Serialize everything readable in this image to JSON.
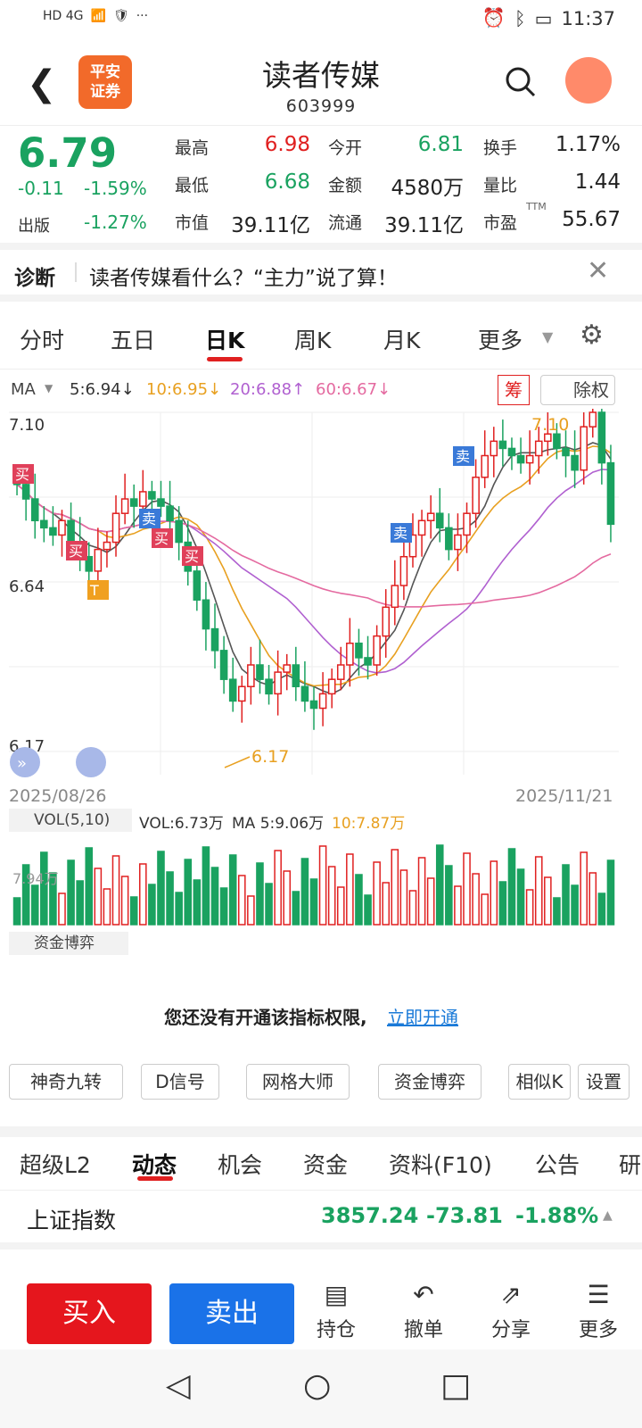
{
  "status": {
    "time": "11:37",
    "net": "HD 4G",
    "dots": "···"
  },
  "header": {
    "title": "读者传媒",
    "code": "603999",
    "logo_line1": "平安",
    "logo_line2": "证券"
  },
  "quote": {
    "price": "6.79",
    "change": "-0.11",
    "change_pct": "-1.59%",
    "sector_label": "出版",
    "sector_pct": "-1.27%",
    "cells": [
      {
        "label": "最高",
        "value": "6.98",
        "color": "#e02020"
      },
      {
        "label": "今开",
        "value": "6.81",
        "color": "#1aa260"
      },
      {
        "label": "换手",
        "value": "1.17%",
        "color": "#222"
      },
      {
        "label": "最低",
        "value": "6.68",
        "color": "#1aa260"
      },
      {
        "label": "金额",
        "value": "4580万",
        "color": "#222"
      },
      {
        "label": "量比",
        "value": "1.44",
        "color": "#222"
      },
      {
        "label": "市值",
        "value": "39.11亿",
        "color": "#222"
      },
      {
        "label": "流通",
        "value": "39.11亿",
        "color": "#222"
      },
      {
        "label": "市盈",
        "value": "55.67",
        "color": "#222"
      }
    ],
    "ttm": "TTM"
  },
  "diagnosis": {
    "tag": "诊断",
    "text": "读者传媒看什么？“主力”说了算！"
  },
  "tabs": [
    "分时",
    "五日",
    "日K",
    "周K",
    "月K",
    "更多"
  ],
  "ma": {
    "label": "MA",
    "ma5": "5:6.94↓",
    "ma10": "10:6.95↓",
    "ma20": "20:6.88↑",
    "ma60": "60:6.67↓",
    "chip": "筹",
    "exright": "除权"
  },
  "chart_data": {
    "type": "candlestick",
    "ymax_label": "7.10",
    "ymin_label": "6.17",
    "mid_label": "6.64",
    "high_mark": "7.10",
    "low_mark": "6.17",
    "start_date": "2025/08/26",
    "end_date": "2025/11/21",
    "ylim": [
      6.17,
      7.1
    ],
    "signals": [
      "买",
      "买",
      "卖",
      "买",
      "买",
      "卖",
      "卖",
      "T"
    ]
  },
  "vol": {
    "label": "VOL(5,10)",
    "vol": "VOL:6.73万",
    "ma5": "MA 5:9.06万",
    "ma10": "10:7.87万",
    "axis": "7.94万"
  },
  "fund": {
    "label": "资金博弈",
    "msg": "您还没有开通该指标权限,",
    "link": "立即开通"
  },
  "tools": [
    "神奇九转",
    "D信号",
    "网格大师",
    "资金博弈",
    "相似K",
    "设置"
  ],
  "subtabs": [
    "超级L2",
    "动态",
    "机会",
    "资金",
    "资料(F10)",
    "公告",
    "研"
  ],
  "index": {
    "name": "上证指数",
    "value": "3857.24",
    "change": "-73.81",
    "pct": "-1.88%"
  },
  "bottom": {
    "buy": "买入",
    "sell": "卖出",
    "icons": [
      "持仓",
      "撤单",
      "分享",
      "更多"
    ]
  }
}
